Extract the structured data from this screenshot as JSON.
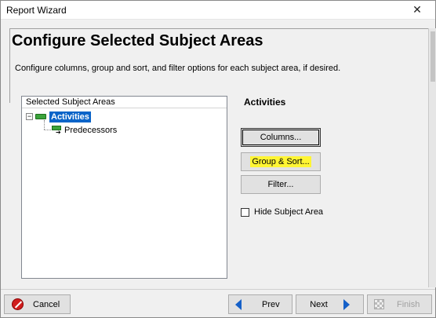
{
  "window": {
    "title": "Report Wizard",
    "close_glyph": "✕"
  },
  "header": {
    "heading": "Configure Selected Subject Areas",
    "description": "Configure columns, group and sort, and filter options for each subject area, if desired."
  },
  "tree": {
    "header": "Selected Subject Areas",
    "expander_glyph": "−",
    "root_label": "Activities",
    "child_label": "Predecessors",
    "root_icon": "green-bar-icon",
    "child_icon": "relationship-arrow-icon"
  },
  "details": {
    "area_title": "Activities",
    "columns_button": "Columns...",
    "group_sort_button": "Group & Sort...",
    "filter_button": "Filter...",
    "hide_checkbox_label": "Hide Subject Area",
    "hide_checked": false
  },
  "footer": {
    "cancel": "Cancel",
    "prev": "Prev",
    "next": "Next",
    "finish": "Finish"
  },
  "colors": {
    "selection": "#0a64c8",
    "highlight": "#fff533",
    "nav_arrow": "#1560c8",
    "cancel_icon": "#d01d1d"
  }
}
